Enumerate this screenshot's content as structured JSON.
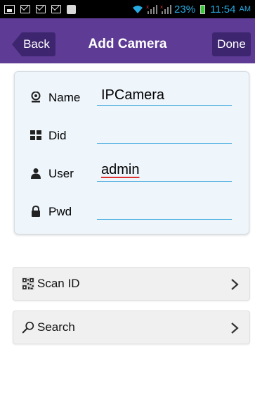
{
  "status_bar": {
    "battery": "23%",
    "time": "11:54",
    "ampm": "AM"
  },
  "header": {
    "back_label": "Back",
    "title": "Add Camera",
    "done_label": "Done",
    "bar_color": "#5e3c95",
    "button_color": "#3e2570"
  },
  "form": {
    "name": {
      "label": "Name",
      "value": "IPCamera",
      "icon": "webcam-icon"
    },
    "did": {
      "label": "Did",
      "value": "",
      "icon": "grid-icon"
    },
    "user": {
      "label": "User",
      "value": "admin",
      "icon": "person-icon"
    },
    "pwd": {
      "label": "Pwd",
      "value": "",
      "icon": "lock-icon"
    },
    "underline_color": "#33a3dc"
  },
  "actions": {
    "scan": {
      "label": "Scan ID",
      "icon": "qr-code-icon"
    },
    "search": {
      "label": "Search",
      "icon": "magnifier-icon"
    }
  }
}
